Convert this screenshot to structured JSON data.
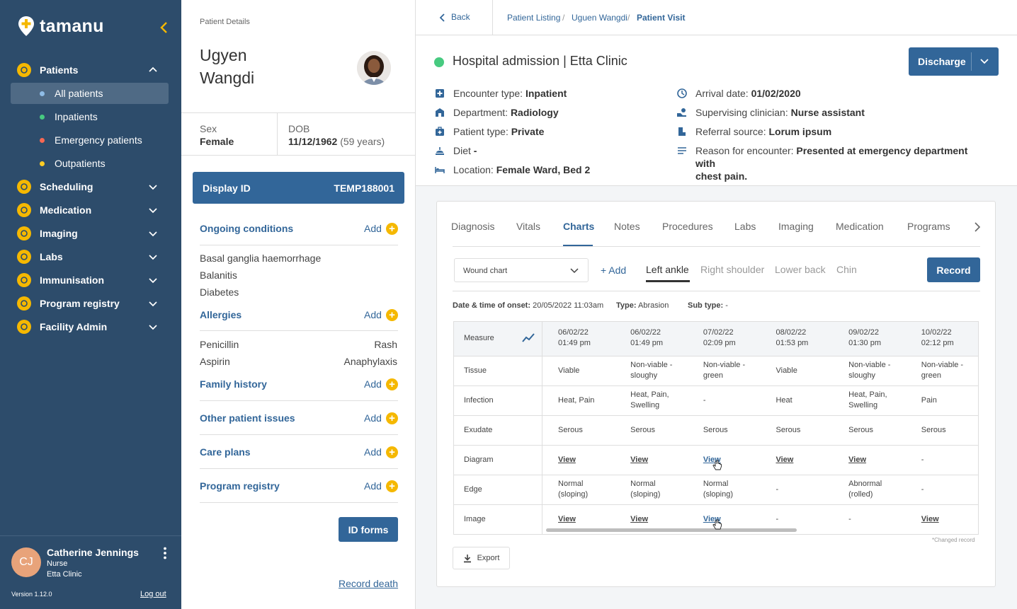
{
  "app": {
    "name": "tamanu",
    "version": "Version 1.12.0"
  },
  "sidebar": {
    "sections": [
      {
        "label": "Patients",
        "icon": "patients-icon",
        "expanded": true
      },
      {
        "label": "Scheduling",
        "icon": "calendar-icon"
      },
      {
        "label": "Medication",
        "icon": "medication-icon"
      },
      {
        "label": "Imaging",
        "icon": "imaging-icon"
      },
      {
        "label": "Labs",
        "icon": "labs-icon"
      },
      {
        "label": "Immunisation",
        "icon": "immunisation-icon"
      },
      {
        "label": "Program registry",
        "icon": "program-registry-icon"
      },
      {
        "label": "Facility Admin",
        "icon": "facility-admin-icon"
      }
    ],
    "patient_items": [
      {
        "label": "All patients",
        "color": "#8fbce6",
        "active": true
      },
      {
        "label": "Inpatients",
        "color": "#47ca80"
      },
      {
        "label": "Emergency patients",
        "color": "#f76853"
      },
      {
        "label": "Outpatients",
        "color": "#ffcc24"
      }
    ],
    "user": {
      "initials": "CJ",
      "name": "Catherine Jennings",
      "role": "Nurse",
      "clinic": "Etta Clinic",
      "logout": "Log out"
    }
  },
  "patient": {
    "panel_title": "Patient Details",
    "first_name": "Ugyen",
    "last_name": "Wangdi",
    "sex_label": "Sex",
    "sex": "Female",
    "dob_label": "DOB",
    "dob": "11/12/1962",
    "age": "(59 years)",
    "display_id_label": "Display ID",
    "display_id": "TEMP188001",
    "add_label": "Add",
    "ongoing_title": "Ongoing conditions",
    "conditions": [
      "Basal ganglia haemorrhage",
      "Balanitis",
      "Diabetes"
    ],
    "allergies_title": "Allergies",
    "allergies": [
      {
        "name": "Penicillin",
        "reaction": "Rash"
      },
      {
        "name": "Aspirin",
        "reaction": "Anaphylaxis"
      }
    ],
    "family_title": "Family history",
    "other_title": "Other patient issues",
    "care_title": "Care plans",
    "registry_title": "Program registry",
    "id_forms": "ID forms",
    "record_death": "Record death"
  },
  "breadcrumb": {
    "back": "Back",
    "items": [
      "Patient Listing",
      "Uguen Wangdi",
      "Patient Visit"
    ]
  },
  "encounter": {
    "title": "Hospital admission | Etta Clinic",
    "discharge": "Discharge",
    "details_left": [
      {
        "label": "Encounter type:",
        "value": "Inpatient",
        "icon": "encounter-type-icon"
      },
      {
        "label": "Department:",
        "value": "Radiology",
        "icon": "department-icon"
      },
      {
        "label": "Patient type:",
        "value": "Private",
        "icon": "patient-type-icon"
      },
      {
        "label": "Diet",
        "value": "-",
        "icon": "diet-icon"
      },
      {
        "label": "Location:",
        "value": "Female Ward, Bed 2",
        "icon": "location-icon"
      }
    ],
    "details_right": [
      {
        "label": "Arrival date:",
        "value": "01/02/2020",
        "icon": "arrival-date-icon"
      },
      {
        "label": "Supervising clinician:",
        "value": "Nurse assistant",
        "icon": "clinician-icon"
      },
      {
        "label": "Referral source:",
        "value": "Lorum ipsum",
        "icon": "referral-icon"
      },
      {
        "label": "Reason for encounter:",
        "value": "Presented at emergency department with",
        "value2": "chest pain.",
        "icon": "reason-icon"
      }
    ]
  },
  "tabs": [
    "Diagnosis",
    "Vitals",
    "Charts",
    "Notes",
    "Procedures",
    "Labs",
    "Imaging",
    "Medication",
    "Programs"
  ],
  "active_tab": "Charts",
  "charts": {
    "chart_select": "Wound chart",
    "add_label": "+ Add",
    "chart_tabs": [
      "Left ankle",
      "Right shoulder",
      "Lower back",
      "Chin"
    ],
    "record": "Record",
    "onset_label": "Date & time of onset:",
    "onset_value": "20/05/2022 11:03am",
    "type_label": "Type:",
    "type_value": "Abrasion",
    "subtype_label": "Sub type:",
    "subtype_value": "-",
    "measure_label": "Measure",
    "columns": [
      {
        "date": "06/02/22",
        "time": "01:49 pm"
      },
      {
        "date": "06/02/22",
        "time": "01:49 pm"
      },
      {
        "date": "07/02/22",
        "time": "02:09 pm"
      },
      {
        "date": "08/02/22",
        "time": "01:53 pm"
      },
      {
        "date": "09/02/22",
        "time": "01:30 pm"
      },
      {
        "date": "10/02/22",
        "time": "02:12 pm"
      }
    ],
    "rows": [
      {
        "measure": "Tissue",
        "values": [
          "Viable",
          "Non-viable - sloughy",
          "Non-viable - green",
          "Viable",
          "Non-viable - sloughy",
          "Non-viable - green"
        ]
      },
      {
        "measure": "Infection",
        "values": [
          "Heat, Pain",
          "Heat, Pain, Swelling",
          "-",
          "Heat",
          "Heat, Pain, Swelling",
          "Pain"
        ]
      },
      {
        "measure": "Exudate",
        "values": [
          "Serous",
          "Serous",
          "Serous",
          "Serous",
          "Serous",
          "Serous"
        ]
      },
      {
        "measure": "Diagram",
        "values": [
          "View",
          "View",
          "View",
          "View",
          "View",
          "-"
        ]
      },
      {
        "measure": "Edge",
        "values": [
          "Normal (sloping)",
          "Normal (sloping)",
          "Normal (sloping)",
          "-",
          "Abnormal (rolled)",
          "-"
        ]
      },
      {
        "measure": "Image",
        "values": [
          "View",
          "View",
          "View",
          "-",
          "-",
          "View"
        ]
      }
    ],
    "export": "Export",
    "changed_note": "*Changed record"
  }
}
